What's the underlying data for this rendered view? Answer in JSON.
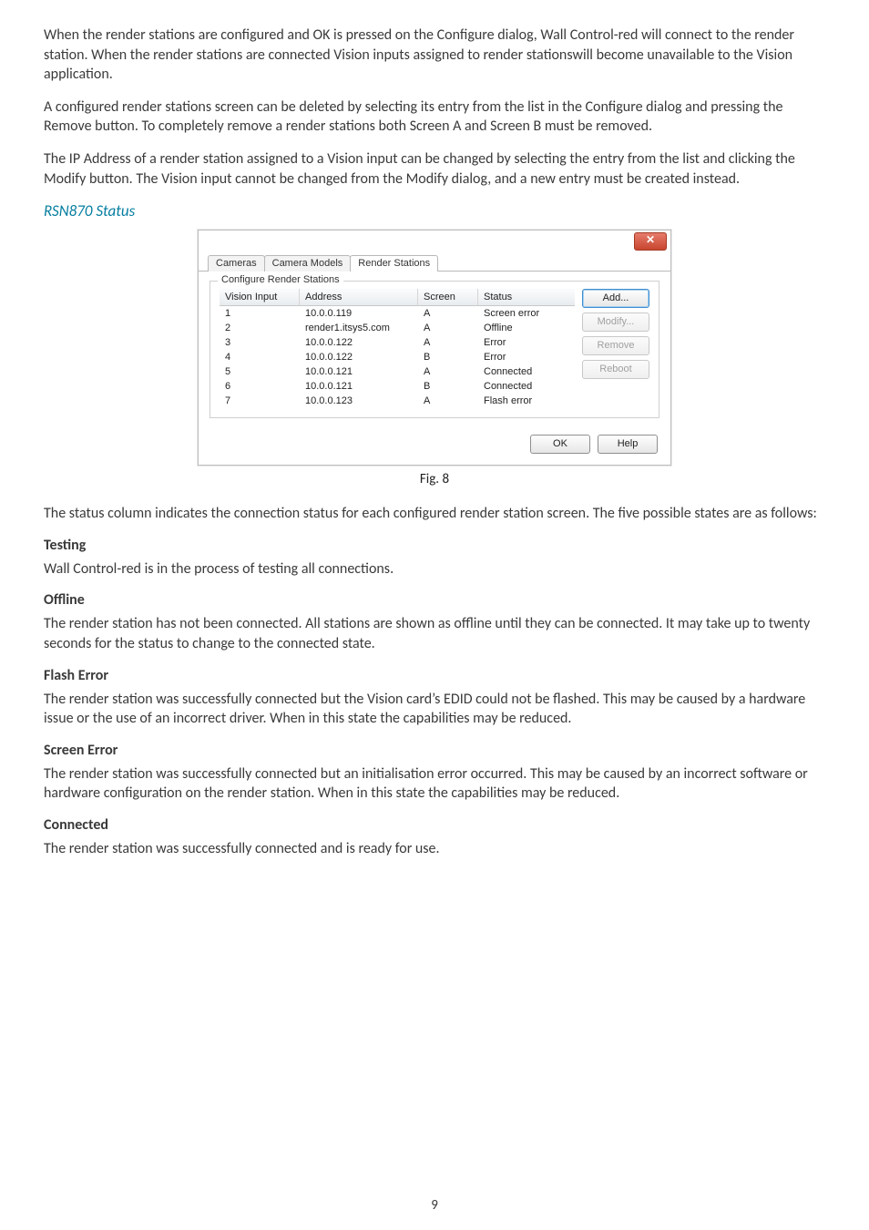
{
  "paragraphs": {
    "p1": "When the render stations are configured and OK is pressed on the Configure dialog, Wall Control-red will connect to the render station. When the render stations are connected Vision inputs assigned to render stationswill become unavailable to the Vision application.",
    "p2": "A configured render stations screen can be deleted by selecting its entry from the list in the Configure dialog and pressing the Remove button. To completely remove a render stations both Screen A and Screen B must be removed.",
    "p3": "The IP Address of a render station assigned to a Vision input can be changed by selecting the entry from the list and clicking the Modify button. The Vision input cannot be changed from the Modify dialog, and a new entry must be created instead.",
    "status_intro": "The status column indicates the connection status for each configured render station screen. The five possible states are as follows:",
    "testing": "Wall Control-red is in the process of testing all connections.",
    "offline": "The render station has not been connected. All stations are shown as offline until they can be connected. It may take up to twenty seconds for the status to change to the connected state.",
    "flash": "The render station was successfully connected but the Vision card’s EDID could not be flashed. This may be caused by a hardware issue or the use of an incorrect driver. When in this state the capabilities may be reduced.",
    "screen": "The render station was successfully connected but an initialisation error occurred. This may be caused by an incorrect software or hardware configuration on the render station. When in this state the capabilities may be reduced.",
    "connected": "The render station was successfully connected and is ready for use."
  },
  "headings": {
    "rsn": "RSN870 Status",
    "testing": "Testing",
    "offline": "Offline",
    "flash": "Flash Error",
    "screen": "Screen Error",
    "connected": "Connected"
  },
  "figure": {
    "caption": "Fig. 8"
  },
  "dialog": {
    "close_glyph": "✕",
    "tabs": {
      "cameras": "Cameras",
      "models": "Camera Models",
      "render": "Render Stations"
    },
    "group_label": "Configure Render Stations",
    "columns": {
      "vision": "Vision Input",
      "address": "Address",
      "screen": "Screen",
      "status": "Status"
    },
    "rows": [
      {
        "vision": "1",
        "address": "10.0.0.119",
        "screen": "A",
        "status": "Screen error"
      },
      {
        "vision": "2",
        "address": "render1.itsys5.com",
        "screen": "A",
        "status": "Offline"
      },
      {
        "vision": "3",
        "address": "10.0.0.122",
        "screen": "A",
        "status": "Error"
      },
      {
        "vision": "4",
        "address": "10.0.0.122",
        "screen": "B",
        "status": "Error"
      },
      {
        "vision": "5",
        "address": "10.0.0.121",
        "screen": "A",
        "status": "Connected"
      },
      {
        "vision": "6",
        "address": "10.0.0.121",
        "screen": "B",
        "status": "Connected"
      },
      {
        "vision": "7",
        "address": "10.0.0.123",
        "screen": "A",
        "status": "Flash error"
      }
    ],
    "buttons": {
      "add": "Add...",
      "modify": "Modify...",
      "remove": "Remove",
      "reboot": "Reboot",
      "ok": "OK",
      "help": "Help"
    }
  },
  "page_number": "9"
}
